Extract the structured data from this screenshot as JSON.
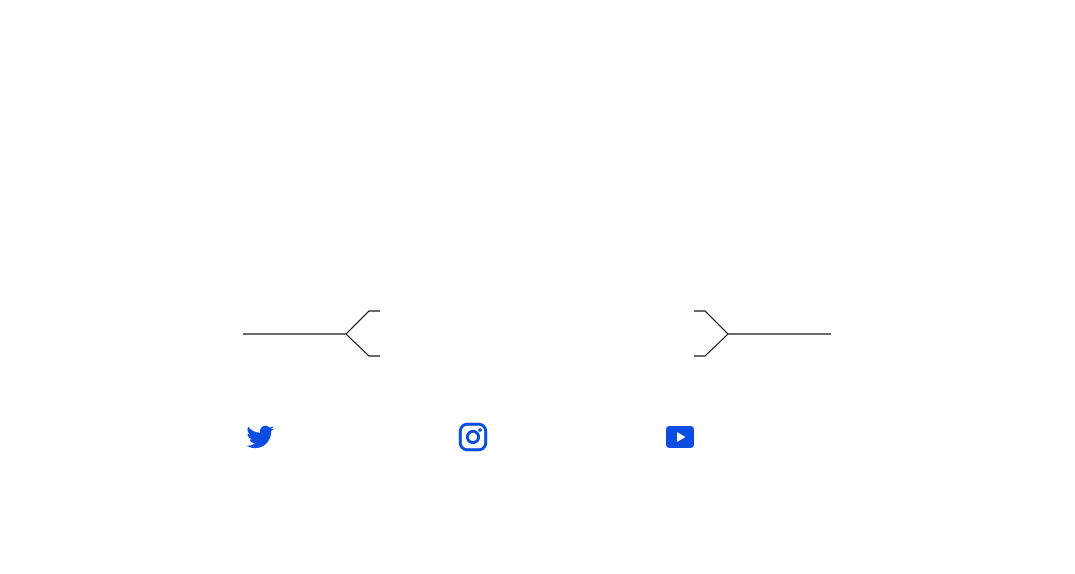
{
  "colors": {
    "icon": "#0b4de0",
    "rule": "#111111",
    "background": "#ffffff"
  },
  "social": {
    "items": [
      {
        "id": "twitter",
        "icon": "twitter-icon"
      },
      {
        "id": "instagram",
        "icon": "instagram-icon"
      },
      {
        "id": "youtube",
        "icon": "youtube-icon"
      }
    ]
  }
}
